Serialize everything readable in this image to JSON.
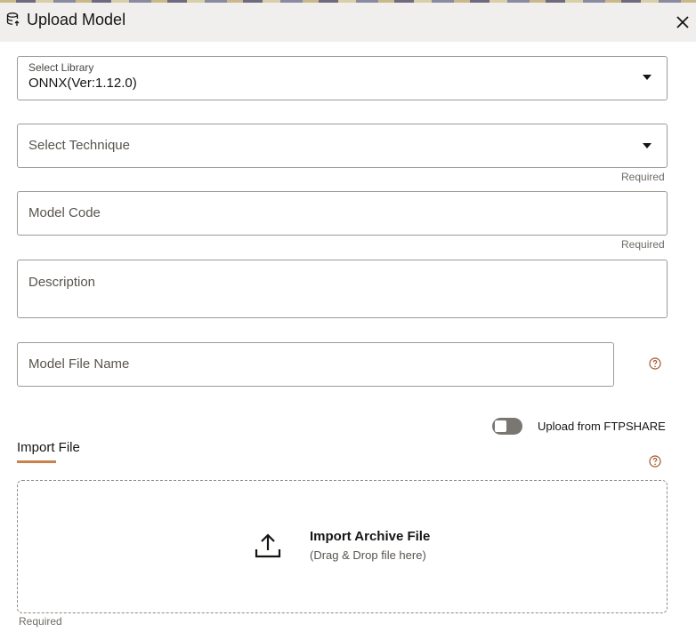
{
  "dialog": {
    "title": "Upload Model",
    "title_icon": "database-upload-icon",
    "close_icon": "close-icon"
  },
  "form": {
    "library": {
      "label": "Select Library",
      "value": "ONNX(Ver:1.12.0)"
    },
    "technique": {
      "placeholder": "Select Technique",
      "required_text": "Required"
    },
    "model_code": {
      "placeholder": "Model Code",
      "required_text": "Required"
    },
    "description": {
      "placeholder": "Description"
    },
    "model_file_name": {
      "placeholder": "Model File Name",
      "help_icon": "help-icon"
    },
    "ftpshare_toggle": {
      "label": "Upload from FTPSHARE",
      "checked": false
    },
    "import_tab": {
      "label": "Import File"
    },
    "dropzone": {
      "title": "Import Archive File",
      "subtitle": "(Drag & Drop file here)",
      "icon": "upload-icon",
      "required_text": "Required"
    }
  },
  "colors": {
    "header_bg": "#f1efed",
    "tab_accent": "#c9824c",
    "toggle_off": "#7a7773",
    "border": "#9e9a95"
  }
}
